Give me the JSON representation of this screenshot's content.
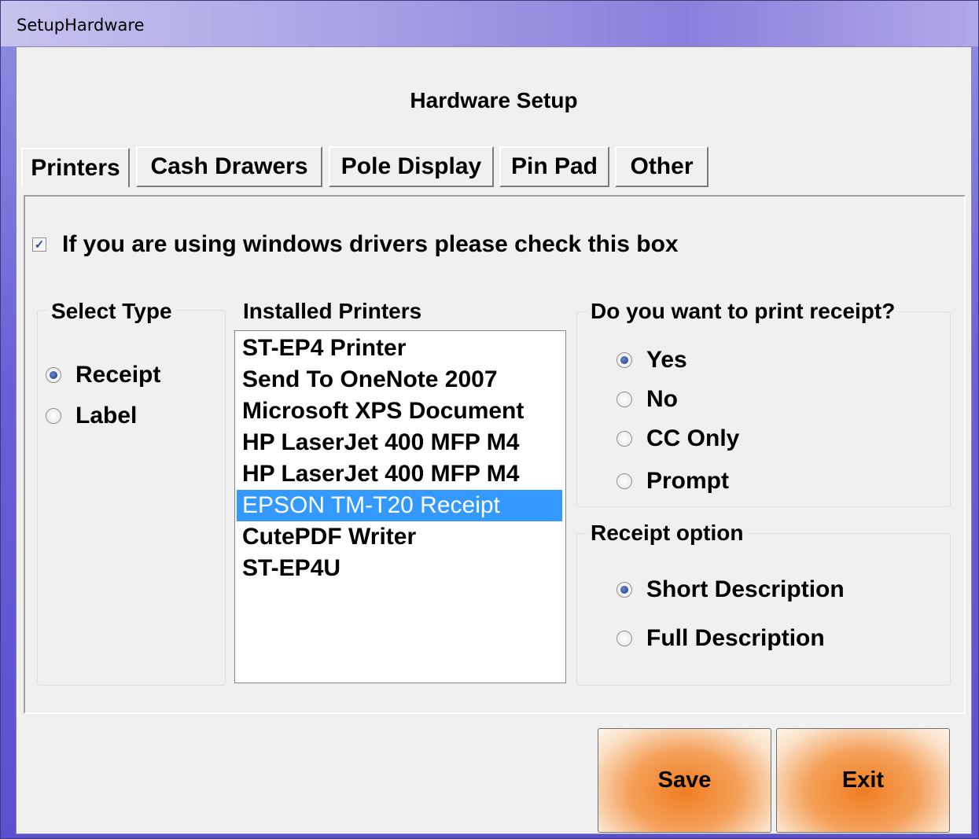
{
  "window": {
    "title": "SetupHardware"
  },
  "heading": "Hardware Setup",
  "tabs": [
    {
      "label": "Printers",
      "active": true
    },
    {
      "label": "Cash Drawers",
      "active": false
    },
    {
      "label": "Pole Display",
      "active": false
    },
    {
      "label": "Pin Pad",
      "active": false
    },
    {
      "label": "Other",
      "active": false
    }
  ],
  "windows_drivers": {
    "label": "If you are using windows drivers please check this box",
    "checked": true
  },
  "select_type": {
    "title": "Select Type",
    "options": [
      {
        "label": "Receipt",
        "selected": true
      },
      {
        "label": "Label",
        "selected": false
      }
    ]
  },
  "installed_printers": {
    "title": "Installed Printers",
    "items": [
      "ST-EP4 Printer",
      "Send To OneNote 2007",
      "Microsoft XPS Document",
      "HP LaserJet 400 MFP M4",
      "HP LaserJet 400 MFP M4",
      "EPSON TM-T20 Receipt",
      "CutePDF Writer",
      "ST-EP4U"
    ],
    "selected": "EPSON TM-T20 Receipt"
  },
  "print_receipt": {
    "title": "Do you want to print receipt?",
    "options": [
      {
        "label": "Yes",
        "selected": true
      },
      {
        "label": "No",
        "selected": false
      },
      {
        "label": "CC Only",
        "selected": false
      },
      {
        "label": "Prompt",
        "selected": false
      }
    ]
  },
  "receipt_option": {
    "title": "Receipt option",
    "options": [
      {
        "label": "Short Description",
        "selected": true
      },
      {
        "label": "Full Description",
        "selected": false
      }
    ]
  },
  "buttons": {
    "save": "Save",
    "exit": "Exit"
  },
  "colors": {
    "selection": "#3399ff",
    "button_accent": "#f07d21",
    "radio_dot": "#2b4d9a"
  }
}
